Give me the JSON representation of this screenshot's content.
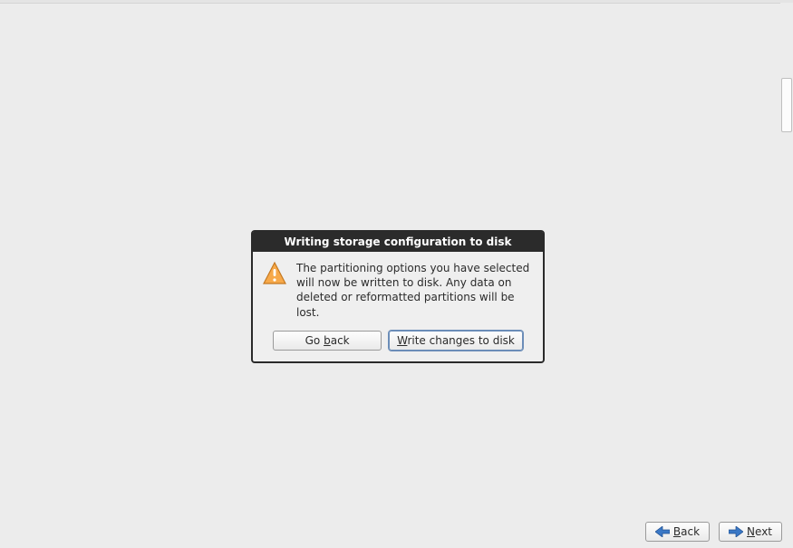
{
  "dialog": {
    "title": "Writing storage configuration to disk",
    "message": "The partitioning options you have selected will now be written to disk.  Any data on deleted or reformatted partitions will be lost.",
    "go_back": {
      "pre": "Go ",
      "hot": "b",
      "post": "ack"
    },
    "write": {
      "hot": "W",
      "post": "rite changes to disk"
    }
  },
  "footer": {
    "back": {
      "hot": "B",
      "post": "ack"
    },
    "next": {
      "hot": "N",
      "post": "ext"
    }
  },
  "colors": {
    "arrow_back": "#3a78c6",
    "arrow_next": "#3a78c6",
    "warn_fill": "#f7a94a",
    "warn_stroke": "#c47820"
  }
}
